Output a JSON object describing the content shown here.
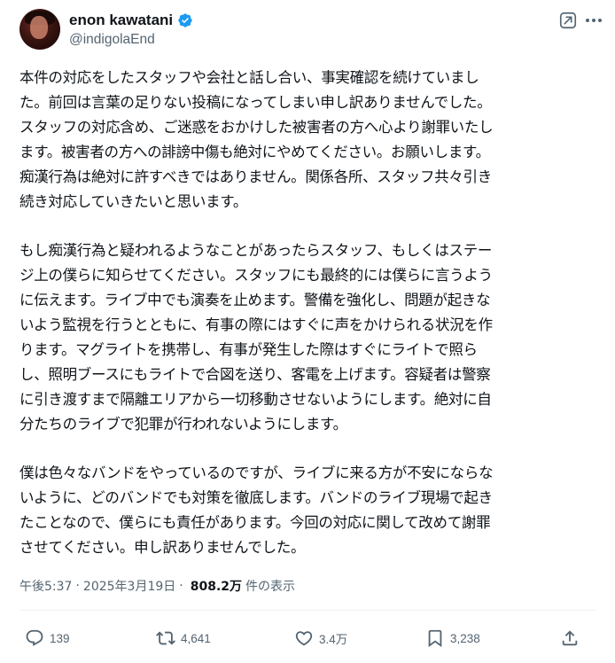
{
  "author": {
    "display_name": "enon kawatani",
    "handle": "@indigolaEnd",
    "verified": true,
    "accent_color": "#1d9bf0"
  },
  "icons": {
    "verified": "verified-badge-icon",
    "grok": "grok-icon",
    "more": "more-horizontal-icon",
    "reply": "reply-icon",
    "retweet": "retweet-icon",
    "like": "heart-icon",
    "bookmark": "bookmark-icon",
    "share": "share-icon"
  },
  "post": {
    "paragraphs": [
      {
        "lines": [
          "本件の対応をしたスタッフや会社と話し合い、事実確認を続けていまし",
          "た。前回は言葉の足りない投稿になってしまい申し訳ありませんでした。",
          "スタッフの対応含め、ご迷惑をおかけした被害者の方へ心より謝罪いたし",
          "ます。被害者の方への誹謗中傷も絶対にやめてください。お願いします。",
          "痴漢行為は絶対に許すべきではありません。関係各所、スタッフ共々引き",
          "続き対応していきたいと思います。"
        ]
      },
      {
        "lines": [
          "もし痴漢行為と疑われるようなことがあったらスタッフ、もしくはステー",
          "ジ上の僕らに知らせてください。スタッフにも最終的には僕らに言うよう",
          "に伝えます。ライブ中でも演奏を止めます。警備を強化し、問題が起きな",
          "いよう監視を行うとともに、有事の際にはすぐに声をかけられる状況を作",
          "ります。マグライトを携帯し、有事が発生した際はすぐにライトで照ら",
          "し、照明ブースにもライトで合図を送り、客電を上げます。容疑者は警察",
          "に引き渡すまで隔離エリアから一切移動させないようにします。絶対に自",
          "分たちのライブで犯罪が行われないようにします。"
        ]
      },
      {
        "lines": [
          "僕は色々なバンドをやっているのですが、ライブに来る方が不安にならな",
          "いように、どのバンドでも対策を徹底します。バンドのライブ現場で起き",
          "たことなので、僕らにも責任があります。今回の対応に関して改めて謝罪",
          "させてください。申し訳ありませんでした。"
        ]
      }
    ]
  },
  "meta": {
    "time": "午後5:37",
    "separator": "·",
    "date": "2025年3月19日",
    "views_count": "808.2万",
    "views_label": "件の表示"
  },
  "actions": {
    "reply_count": "139",
    "retweet_count": "4,641",
    "like_count": "3.4万",
    "bookmark_count": "3,238"
  },
  "colors": {
    "text": "#0f1419",
    "secondary": "#536471",
    "divider": "#eff3f4"
  }
}
